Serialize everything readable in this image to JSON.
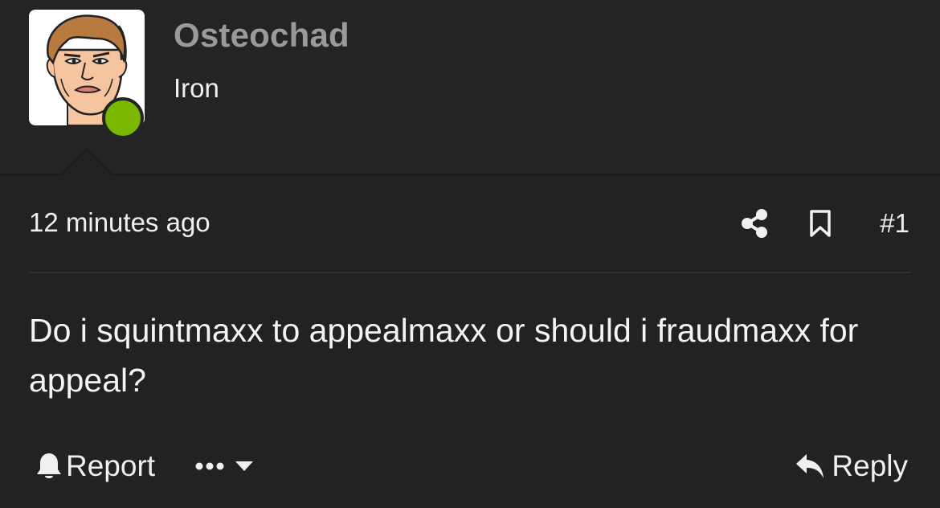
{
  "user": {
    "name": "Osteochad",
    "title": "Iron",
    "status": "online",
    "status_color": "#7ab800"
  },
  "post": {
    "timestamp": "12 minutes ago",
    "number": "#1",
    "body": "Do i squintmaxx to appealmaxx or should i fraudmaxx for appeal?"
  },
  "actions": {
    "share_icon": "share-icon",
    "bookmark_icon": "bookmark-icon",
    "report_label": "Report",
    "report_icon": "bell-icon",
    "more_icon": "ellipsis-icon",
    "more_dropdown_icon": "caret-down-icon",
    "reply_label": "Reply",
    "reply_icon": "reply-icon"
  },
  "colors": {
    "background": "#222222",
    "header_background": "#242424",
    "username": "#9a9a9a",
    "text": "#f0f0f0"
  }
}
